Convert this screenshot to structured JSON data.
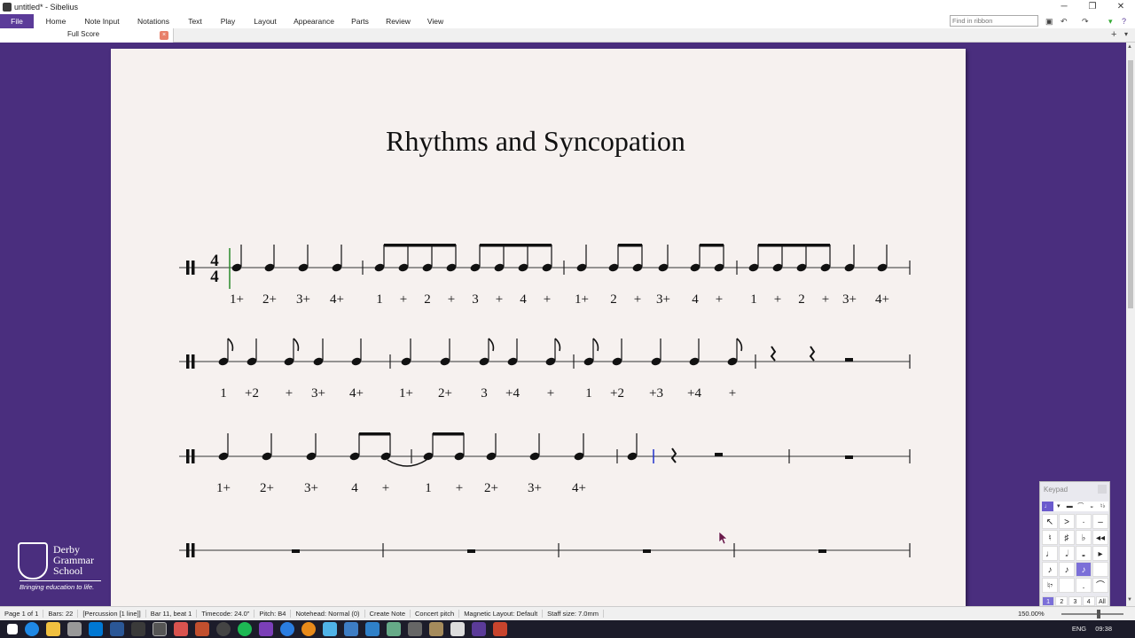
{
  "window": {
    "title": "untitled* - Sibelius",
    "controls": [
      "─",
      "❐",
      "✕"
    ]
  },
  "ribbon": {
    "tabs": [
      "File",
      "Home",
      "Note Input",
      "Notations",
      "Text",
      "Play",
      "Layout",
      "Appearance",
      "Parts",
      "Review",
      "View"
    ],
    "search_placeholder": "Find in ribbon"
  },
  "document_tab": {
    "label": "Full Score",
    "close": "×"
  },
  "score": {
    "title": "Rhythms and Syncopation",
    "time_signature": {
      "top": "4",
      "bottom": "4"
    },
    "rows": [
      {
        "counts": [
          "1+",
          "2+",
          "3+",
          "4+",
          "1",
          "+",
          "2",
          "+",
          "3",
          "+",
          "4",
          "+",
          "1+",
          "2",
          "+",
          "3+",
          "4",
          "+",
          "1",
          "+",
          "2",
          "+",
          "3+",
          "4+"
        ]
      },
      {
        "counts": [
          "1",
          "+2",
          "+",
          "3+",
          "4+",
          "1+",
          "2+",
          "3",
          "+4",
          "+",
          "1",
          "+2",
          "+3",
          "+4",
          "+"
        ]
      },
      {
        "counts": [
          "1+",
          "2+",
          "3+",
          "4",
          "+",
          "1",
          "+",
          "2+",
          "3+",
          "4+"
        ]
      },
      {
        "counts": []
      }
    ]
  },
  "logo": {
    "name_lines": [
      "Derby",
      "Grammar",
      "School"
    ],
    "tagline": "Bringing education to life."
  },
  "keypad": {
    "title": "Keypad",
    "tabs": [
      "♩",
      "▾",
      "▬",
      "⌒",
      "𝄪",
      "♮♭"
    ],
    "keys": [
      "↖",
      ">",
      "·",
      "–",
      "♮",
      "♯",
      "♭",
      "◂◂",
      "♩",
      "𝅗𝅥",
      "𝅝",
      "▸",
      "♪",
      "♪",
      "♪",
      "",
      "♮𝄾",
      "",
      ".",
      "⌒"
    ],
    "selected_key_index": 14,
    "layouts": [
      "1",
      "2",
      "3",
      "4",
      "All"
    ],
    "selected_layout": "1"
  },
  "statusbar": {
    "items": [
      "Page 1 of 1",
      "Bars: 22",
      "[Percussion [1 line]]",
      "Bar 11, beat 1",
      "Timecode: 24.0\"",
      "Pitch: B4",
      "Notehead: Normal (0)",
      "Create Note",
      "Concert pitch",
      "Magnetic Layout: Default",
      "Staff size: 7.0mm"
    ],
    "zoom": "150.00%"
  },
  "taskbar": {
    "lang": "ENG",
    "time": "09:38"
  }
}
